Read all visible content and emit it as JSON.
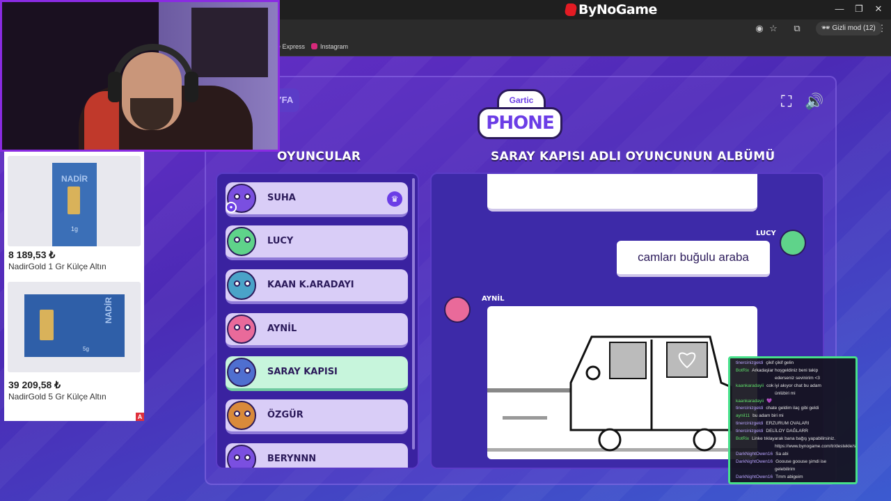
{
  "browser": {
    "brand": "ByNoGame",
    "incognito_label": "Gizli mod (12)",
    "bookmarks": [
      "e Express",
      "Instagram"
    ]
  },
  "game": {
    "back_label": "YFA",
    "logo_top": "Gartic",
    "logo_bottom": "PHONE",
    "players_heading": "OYUNCULAR",
    "album_heading": "SARAY KAPISI ADLI OYUNCUNUN ALBÜMÜ",
    "players": [
      {
        "name": "SUHA",
        "color": "#7a4fe0",
        "host": true
      },
      {
        "name": "LUCY",
        "color": "#5fd38a",
        "host": false
      },
      {
        "name": "KAAN K.ARADAYI",
        "color": "#4aa3c8",
        "host": false
      },
      {
        "name": "AYNİL",
        "color": "#e96a9a",
        "host": false
      },
      {
        "name": "SARAY KAPISI",
        "color": "#4f6fd0",
        "host": false
      },
      {
        "name": "ÖZGÜR",
        "color": "#d98a3a",
        "host": false
      },
      {
        "name": "BERYNNN",
        "color": "#7a4fe0",
        "host": false
      }
    ],
    "active_player_index": 4,
    "album": {
      "speaker_1": "LUCY",
      "message_1": "camları buğulu araba",
      "speaker_2": "AYNİL"
    }
  },
  "ad": {
    "products": [
      {
        "price": "8 189,53 ₺",
        "name": "NadirGold 1 Gr Külçe Altın",
        "card_text": "NADİR",
        "weight": "1g"
      },
      {
        "price": "39 209,58 ₺",
        "name": "NadirGold 5 Gr Külçe Altın",
        "card_text": "NADİR",
        "weight": "5g"
      }
    ],
    "badge": "A"
  },
  "chat": {
    "accent": "#47e08a",
    "lines": [
      {
        "user": "tinercinizgeldi",
        "text": "çikif çikif gelin",
        "user_color": "#b9a4ff"
      },
      {
        "user": "BotRix",
        "text": "Arkadaşlar hoşgeldiniz beni takip",
        "user_color": "#5fe06a"
      },
      {
        "user": "",
        "text": "ederseniz sevinirim <3",
        "user_color": "#5fe06a"
      },
      {
        "user": "kaankaradayii",
        "text": "cok iyi akıyor chat bu adam",
        "user_color": "#5fe06a"
      },
      {
        "user": "",
        "text": "ünlübiri mi",
        "user_color": "#5fe06a"
      },
      {
        "user": "kaankaradayii",
        "text": "💜",
        "user_color": "#5fe06a"
      },
      {
        "user": "tinercinizgeldi",
        "text": "chate geldim ilaç gibi geldi",
        "user_color": "#b9a4ff"
      },
      {
        "user": "aynil11",
        "text": "bu adam biri mi",
        "user_color": "#5fe06a"
      },
      {
        "user": "tinercinizgeldi",
        "text": "ERZURUM OVALARI",
        "user_color": "#b9a4ff"
      },
      {
        "user": "tinercinizgeldi",
        "text": "DELİLOY DAĞLARR",
        "user_color": "#b9a4ff"
      },
      {
        "user": "BotRix",
        "text": "Linke tıklayarak bana bağış yapabilirsiniz.",
        "user_color": "#5fe06a"
      },
      {
        "user": "",
        "text": "https://www.bynogame.com/tr/destekle/suhayar",
        "user_color": "#5fe06a"
      },
      {
        "user": "DarkNightOwen16",
        "text": "Sa abi",
        "user_color": "#b9a4ff"
      },
      {
        "user": "DarkNightOwen16",
        "text": "Goouse goouse şimdi ise",
        "user_color": "#b9a4ff"
      },
      {
        "user": "",
        "text": "gelebilirim",
        "user_color": "#b9a4ff"
      },
      {
        "user": "DarkNightOwen16",
        "text": "Tmm abigeim",
        "user_color": "#b9a4ff"
      }
    ]
  }
}
